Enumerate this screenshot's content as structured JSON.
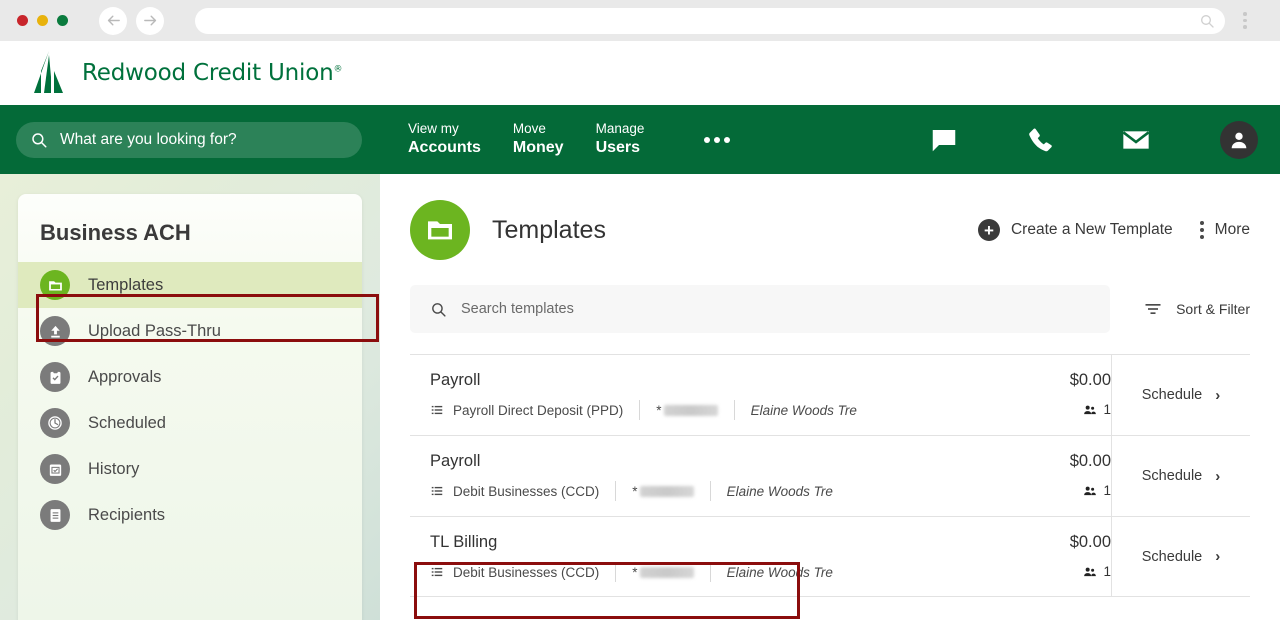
{
  "browser": {
    "traffic_lights": [
      "red",
      "yellow",
      "green"
    ],
    "back_icon": "back-arrow-icon",
    "forward_icon": "forward-arrow-icon",
    "url_value": "",
    "url_search_icon": "search-icon",
    "menu_icon": "browser-menu-icon"
  },
  "brand": {
    "name": "Redwood Credit Union",
    "registered_mark": "®",
    "logo_icon": "redwood-tree-logo",
    "color": "#00713c"
  },
  "topnav": {
    "background": "#046a38",
    "search": {
      "placeholder": "What are you looking for?",
      "icon": "search-icon",
      "value": ""
    },
    "links": [
      {
        "line1": "View my",
        "line2": "Accounts"
      },
      {
        "line1": "Move",
        "line2": "Money"
      },
      {
        "line1": "Manage",
        "line2": "Users"
      }
    ],
    "overflow_icon": "ellipsis-icon",
    "icons": [
      {
        "name": "chat-icon"
      },
      {
        "name": "phone-icon"
      },
      {
        "name": "mail-icon"
      }
    ],
    "avatar_icon": "user-avatar-icon"
  },
  "sidebar": {
    "title": "Business ACH",
    "items": [
      {
        "label": "Templates",
        "icon": "folder-icon",
        "active": true
      },
      {
        "label": "Upload Pass-Thru",
        "icon": "upload-icon",
        "active": false
      },
      {
        "label": "Approvals",
        "icon": "clipboard-check-icon",
        "active": false
      },
      {
        "label": "Scheduled",
        "icon": "clock-icon",
        "active": false
      },
      {
        "label": "History",
        "icon": "calendar-check-icon",
        "active": false
      },
      {
        "label": "Recipients",
        "icon": "list-document-icon",
        "active": false
      }
    ],
    "active_accent": "#6cb520",
    "highlight_color": "#8b0d0d"
  },
  "main": {
    "page_title": "Templates",
    "page_icon": "folder-icon",
    "create_button": {
      "label": "Create a New Template",
      "icon": "plus-circle-icon"
    },
    "more_button": {
      "label": "More",
      "icon": "kebab-menu-icon"
    },
    "search": {
      "placeholder": "Search templates",
      "value": "",
      "icon": "search-icon"
    },
    "sort_filter": {
      "label": "Sort & Filter",
      "icon": "filter-icon"
    },
    "rows": [
      {
        "name": "Payroll",
        "type": "Payroll Direct Deposit (PPD)",
        "type_icon": "list-icon",
        "account_mask": "*",
        "account_redacted": true,
        "owner": "Elaine Woods Tre",
        "amount": "$0.00",
        "recipients_icon": "people-icon",
        "recipients_count": "1",
        "action_label": "Schedule",
        "action_icon": "chevron-right-icon",
        "highlighted": false
      },
      {
        "name": "Payroll",
        "type": "Debit Businesses (CCD)",
        "type_icon": "list-icon",
        "account_mask": "*",
        "account_redacted": true,
        "owner": "Elaine Woods Tre",
        "amount": "$0.00",
        "recipients_icon": "people-icon",
        "recipients_count": "1",
        "action_label": "Schedule",
        "action_icon": "chevron-right-icon",
        "highlighted": false
      },
      {
        "name": "TL Billing",
        "type": "Debit Businesses (CCD)",
        "type_icon": "list-icon",
        "account_mask": "*",
        "account_redacted": true,
        "owner": "Elaine Woods Tre",
        "amount": "$0.00",
        "recipients_icon": "people-icon",
        "recipients_count": "1",
        "action_label": "Schedule",
        "action_icon": "chevron-right-icon",
        "highlighted": true
      }
    ]
  }
}
